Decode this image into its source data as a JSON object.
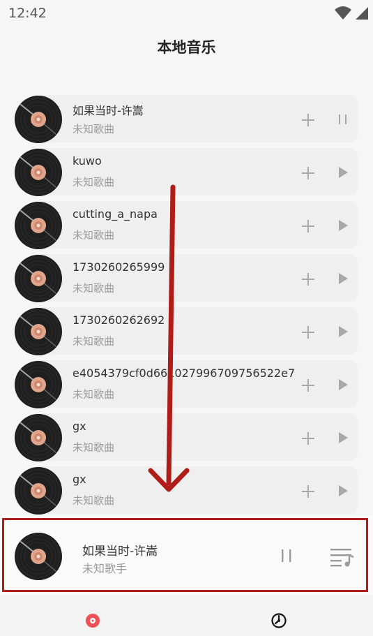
{
  "status_bar": {
    "time": "12:42",
    "icons": [
      "wifi-icon",
      "signal-icon",
      "battery-icon"
    ]
  },
  "page": {
    "title": "本地音乐"
  },
  "songs": [
    {
      "title": "如果当时-许嵩",
      "artist": "未知歌曲",
      "state": "playing",
      "action_icon": "pause-icon"
    },
    {
      "title": "kuwo",
      "artist": "未知歌曲",
      "state": "idle",
      "action_icon": "play-icon"
    },
    {
      "title": "cutting_a_napa",
      "artist": "未知歌曲",
      "state": "idle",
      "action_icon": "play-icon"
    },
    {
      "title": "1730260265999",
      "artist": "未知歌曲",
      "state": "idle",
      "action_icon": "play-icon"
    },
    {
      "title": "1730260262692",
      "artist": "未知歌曲",
      "state": "idle",
      "action_icon": "play-icon"
    },
    {
      "title": "e4054379cf0d661027996709756522e7",
      "artist": "未知歌曲",
      "state": "idle",
      "action_icon": "play-icon"
    },
    {
      "title": "gx",
      "artist": "未知歌曲",
      "state": "idle",
      "action_icon": "play-icon"
    },
    {
      "title": "gx",
      "artist": "未知歌曲",
      "state": "idle",
      "action_icon": "play-icon"
    }
  ],
  "now_playing": {
    "title": "如果当时-许嵩",
    "artist": "未知歌手",
    "controls": [
      "pause-icon",
      "playlist-icon"
    ]
  },
  "bottom_nav": {
    "tabs": [
      {
        "icon": "music-disc-icon",
        "active": true
      },
      {
        "icon": "player-clock-icon",
        "active": false
      }
    ]
  },
  "colors": {
    "annotation": "#b01c18",
    "accent": "#ef4f56",
    "card_bg": "#efefef",
    "page_bg": "#f6f6f6"
  }
}
